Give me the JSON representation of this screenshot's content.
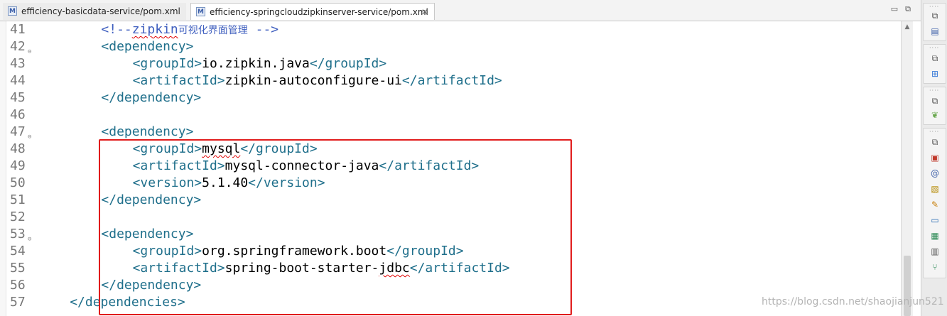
{
  "tabs": [
    {
      "icon": "M",
      "label": "efficiency-basicdata-service/pom.xml"
    },
    {
      "icon": "M",
      "label": "efficiency-springcloudzipkinserver-service/pom.xml",
      "close": "✕"
    }
  ],
  "window_controls": {
    "minimize": "▭",
    "maximize": "⧉"
  },
  "editor": {
    "lines": [
      {
        "num": "41",
        "fold": false,
        "indent": 8,
        "parts": [
          {
            "t": "<!--",
            "c": "cmt"
          },
          {
            "t": "zipkin",
            "c": "cmt squig"
          },
          {
            "t": "可视化界面管理",
            "c": "cjk"
          },
          {
            "t": " -->",
            "c": "cmt"
          }
        ]
      },
      {
        "num": "42",
        "fold": true,
        "indent": 8,
        "parts": [
          {
            "t": "<dependency>",
            "c": "tag"
          }
        ]
      },
      {
        "num": "43",
        "fold": false,
        "indent": 12,
        "parts": [
          {
            "t": "<groupId>",
            "c": "tag"
          },
          {
            "t": "io.zipkin.java",
            "c": "txt"
          },
          {
            "t": "</groupId>",
            "c": "tag"
          }
        ]
      },
      {
        "num": "44",
        "fold": false,
        "indent": 12,
        "parts": [
          {
            "t": "<artifactId>",
            "c": "tag"
          },
          {
            "t": "zipkin-autoconfigure-ui",
            "c": "txt"
          },
          {
            "t": "</artifactId>",
            "c": "tag"
          }
        ]
      },
      {
        "num": "45",
        "fold": false,
        "indent": 8,
        "parts": [
          {
            "t": "</dependency>",
            "c": "tag"
          }
        ]
      },
      {
        "num": "46",
        "fold": false,
        "indent": 0,
        "parts": []
      },
      {
        "num": "47",
        "fold": true,
        "indent": 8,
        "parts": [
          {
            "t": "<dependency>",
            "c": "tag"
          }
        ]
      },
      {
        "num": "48",
        "fold": false,
        "indent": 12,
        "parts": [
          {
            "t": "<groupId>",
            "c": "tag"
          },
          {
            "t": "mysql",
            "c": "txt squig"
          },
          {
            "t": "</groupId>",
            "c": "tag"
          }
        ]
      },
      {
        "num": "49",
        "fold": false,
        "indent": 12,
        "parts": [
          {
            "t": "<artifactId>",
            "c": "tag"
          },
          {
            "t": "mysql-connector-java",
            "c": "txt"
          },
          {
            "t": "</artifactId>",
            "c": "tag"
          }
        ]
      },
      {
        "num": "50",
        "fold": false,
        "indent": 12,
        "parts": [
          {
            "t": "<version>",
            "c": "tag"
          },
          {
            "t": "5.1.40",
            "c": "txt"
          },
          {
            "t": "</version>",
            "c": "tag"
          }
        ]
      },
      {
        "num": "51",
        "fold": false,
        "indent": 8,
        "parts": [
          {
            "t": "</dependency>",
            "c": "tag"
          }
        ]
      },
      {
        "num": "52",
        "fold": false,
        "indent": 0,
        "parts": []
      },
      {
        "num": "53",
        "fold": true,
        "indent": 8,
        "parts": [
          {
            "t": "<dependency>",
            "c": "tag"
          }
        ]
      },
      {
        "num": "54",
        "fold": false,
        "indent": 12,
        "parts": [
          {
            "t": "<groupId>",
            "c": "tag"
          },
          {
            "t": "org.springframework.boot",
            "c": "txt"
          },
          {
            "t": "</groupId>",
            "c": "tag"
          }
        ]
      },
      {
        "num": "55",
        "fold": false,
        "indent": 12,
        "parts": [
          {
            "t": "<artifactId>",
            "c": "tag"
          },
          {
            "t": "spring-boot-starter-",
            "c": "txt"
          },
          {
            "t": "jdbc",
            "c": "txt squig"
          },
          {
            "t": "</artifactId>",
            "c": "tag"
          }
        ]
      },
      {
        "num": "56",
        "fold": false,
        "indent": 8,
        "parts": [
          {
            "t": "</dependency>",
            "c": "tag"
          }
        ]
      },
      {
        "num": "57",
        "fold": false,
        "indent": 4,
        "parts": [
          {
            "t": "</dependencies>",
            "c": "tag"
          }
        ]
      }
    ]
  },
  "watermark": "https://blog.csdn.net/shaojianjun521",
  "colors": {
    "tag": "#1f6f8b",
    "comment": "#3f5fbf",
    "highlight": "#e11c1c"
  }
}
